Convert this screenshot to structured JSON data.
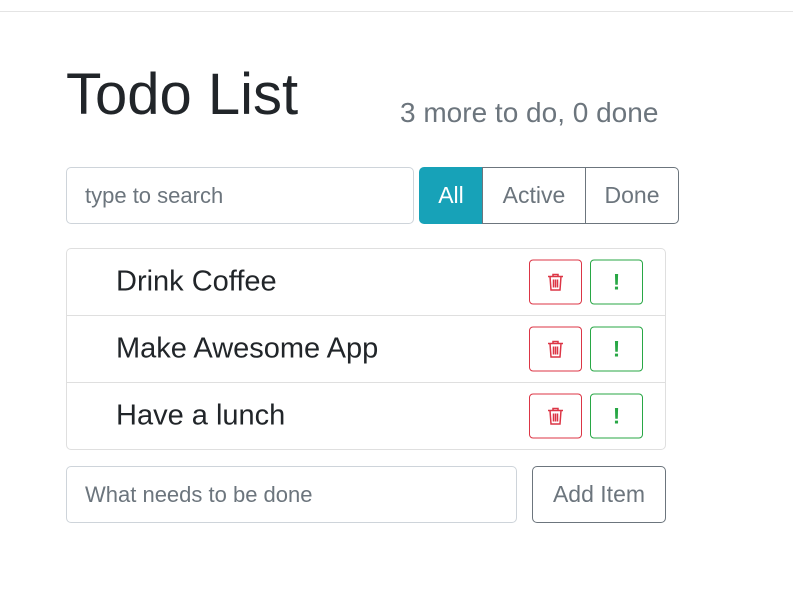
{
  "header": {
    "title": "Todo List",
    "counter": "3 more to do, 0 done"
  },
  "search": {
    "placeholder": "type to search",
    "value": ""
  },
  "filters": [
    {
      "label": "All",
      "selected": true
    },
    {
      "label": "Active",
      "selected": false
    },
    {
      "label": "Done",
      "selected": false
    }
  ],
  "items": [
    {
      "label": "Drink Coffee",
      "delete_icon": "trash-icon",
      "important_icon": "exclamation-icon"
    },
    {
      "label": "Make Awesome App",
      "delete_icon": "trash-icon",
      "important_icon": "exclamation-icon"
    },
    {
      "label": "Have a lunch",
      "delete_icon": "trash-icon",
      "important_icon": "exclamation-icon"
    }
  ],
  "add_form": {
    "placeholder": "What needs to be done",
    "value": "",
    "button_label": "Add Item"
  },
  "colors": {
    "accent": "#17a2b8",
    "danger": "#dc3545",
    "success": "#28a745",
    "muted": "#6c757d"
  }
}
